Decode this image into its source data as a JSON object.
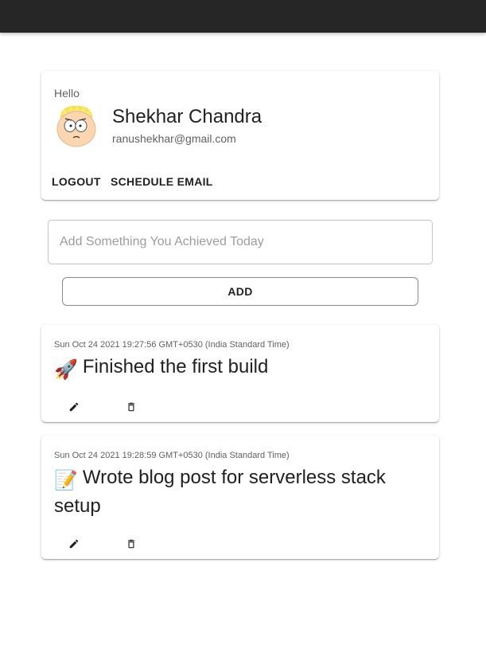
{
  "profile": {
    "greeting": "Hello",
    "name": "Shekhar Chandra",
    "email": "ranushekhar@gmail.com",
    "avatar_icon": "cartoon-avatar-icon",
    "logout_label": "LOGOUT",
    "schedule_label": "SCHEDULE EMAIL"
  },
  "composer": {
    "placeholder": "Add Something You Achieved Today",
    "value": "",
    "add_label": "ADD"
  },
  "entries": [
    {
      "timestamp": "Sun Oct 24 2021 19:27:56 GMT+0530 (India Standard Time)",
      "emoji": "🚀",
      "text": "Finished the first build",
      "edit_icon": "pencil-icon",
      "delete_icon": "trash-icon"
    },
    {
      "timestamp": "Sun Oct 24 2021 19:28:59 GMT+0530 (India Standard Time)",
      "emoji": "📝",
      "text": "Wrote blog post for serverless stack setup",
      "edit_icon": "pencil-icon",
      "delete_icon": "trash-icon"
    }
  ],
  "colors": {
    "appbar": "#262626",
    "text_primary": "#212121",
    "text_secondary": "#616161"
  }
}
